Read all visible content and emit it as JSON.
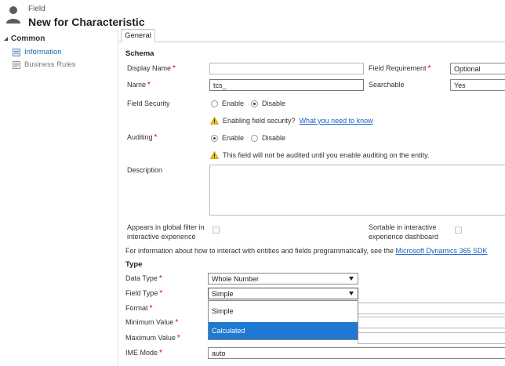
{
  "header": {
    "subtitle": "Field",
    "title": "New for Characteristic"
  },
  "nav": {
    "group": "Common",
    "items": [
      {
        "label": "Information",
        "active": true
      },
      {
        "label": "Business Rules",
        "active": false
      }
    ]
  },
  "tabs": [
    {
      "label": "General"
    }
  ],
  "schema": {
    "title": "Schema",
    "display_name_label": "Display Name",
    "display_name_value": "",
    "field_requirement_label": "Field Requirement",
    "field_requirement_value": "Optional",
    "name_label": "Name",
    "name_value": "tcs_",
    "searchable_label": "Searchable",
    "searchable_value": "Yes",
    "field_security_label": "Field Security",
    "field_security_options": [
      "Enable",
      "Disable"
    ],
    "field_security_selected": "Disable",
    "security_warning_text": "Enabling field security?",
    "security_warning_link": "What you need to know",
    "auditing_label": "Auditing",
    "auditing_options": [
      "Enable",
      "Disable"
    ],
    "auditing_selected": "Enable",
    "auditing_warning": "This field will not be audited until you enable auditing on the entity.",
    "description_label": "Description",
    "description_value": "",
    "global_filter_label": "Appears in global filter in interactive experience",
    "sortable_label": "Sortable in interactive experience dashboard",
    "info_text": "For information about how to interact with entities and fields programmatically, see the",
    "info_link": "Microsoft Dynamics 365 SDK"
  },
  "type": {
    "title": "Type",
    "data_type_label": "Data Type",
    "data_type_value": "Whole Number",
    "field_type_label": "Field Type",
    "field_type_value": "Simple",
    "format_label": "Format",
    "min_label": "Minimum Value",
    "max_label": "Maximum Value",
    "ime_label": "IME Mode",
    "ime_value": "auto",
    "dropdown_options": [
      "Simple",
      "Calculated"
    ],
    "dropdown_highlighted": "Calculated"
  },
  "colors": {
    "accent": "#1f78d1",
    "link": "#1560bd",
    "required": "#d20000",
    "warning": "#f2c200"
  }
}
